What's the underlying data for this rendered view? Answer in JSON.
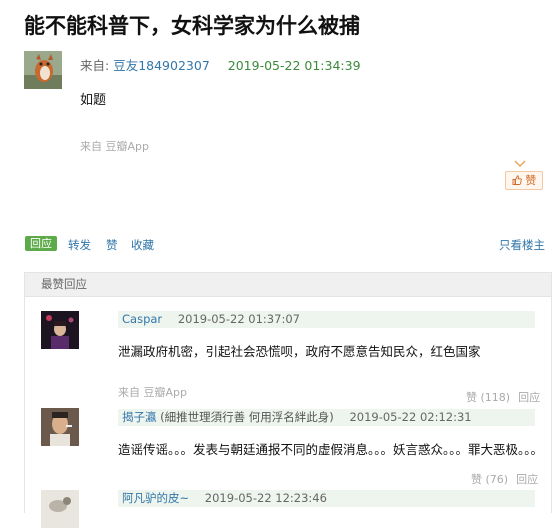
{
  "post": {
    "title": "能不能科普下，女科学家为什么被捕",
    "from_label": "来自:",
    "author": "豆友184902307",
    "time": "2019-05-22 01:34:39",
    "body": "如题",
    "source": "来自 豆瓣App",
    "like_label": "赞"
  },
  "actions": {
    "reply": "回应",
    "repost": "转发",
    "like": "赞",
    "collect": "收藏",
    "only_op": "只看楼主"
  },
  "best_replies": {
    "header": "最赞回应",
    "comments": [
      {
        "user": "Caspar",
        "signature": "",
        "time": "2019-05-22 01:37:07",
        "text": "泄漏政府机密，引起社会恐慌呗，政府不愿意告知民众，红色国家",
        "source": "来自 豆瓣App",
        "like_count": "赞 (118)",
        "reply_label": "回应"
      },
      {
        "user": "揭子瀛",
        "signature": "(細推世理須行善 何用浮名絆此身)",
        "time": "2019-05-22 02:12:31",
        "text": "造谣传谣。。。发表与朝廷通报不同的虚假消息。。。妖言惑众。。。罪大恶极。。。",
        "source": "",
        "like_count": "赞 (76)",
        "reply_label": "回应"
      },
      {
        "user": "阿凡驴的皮~",
        "signature": "",
        "time": "2019-05-22 12:23:46",
        "text": "",
        "source": "",
        "like_count": "",
        "reply_label": ""
      }
    ]
  },
  "colors": {
    "link": "#3377aa",
    "time_green": "#3a8a3a",
    "reply_tag_bg": "#5daa4a",
    "like_orange": "#d06b2b"
  }
}
